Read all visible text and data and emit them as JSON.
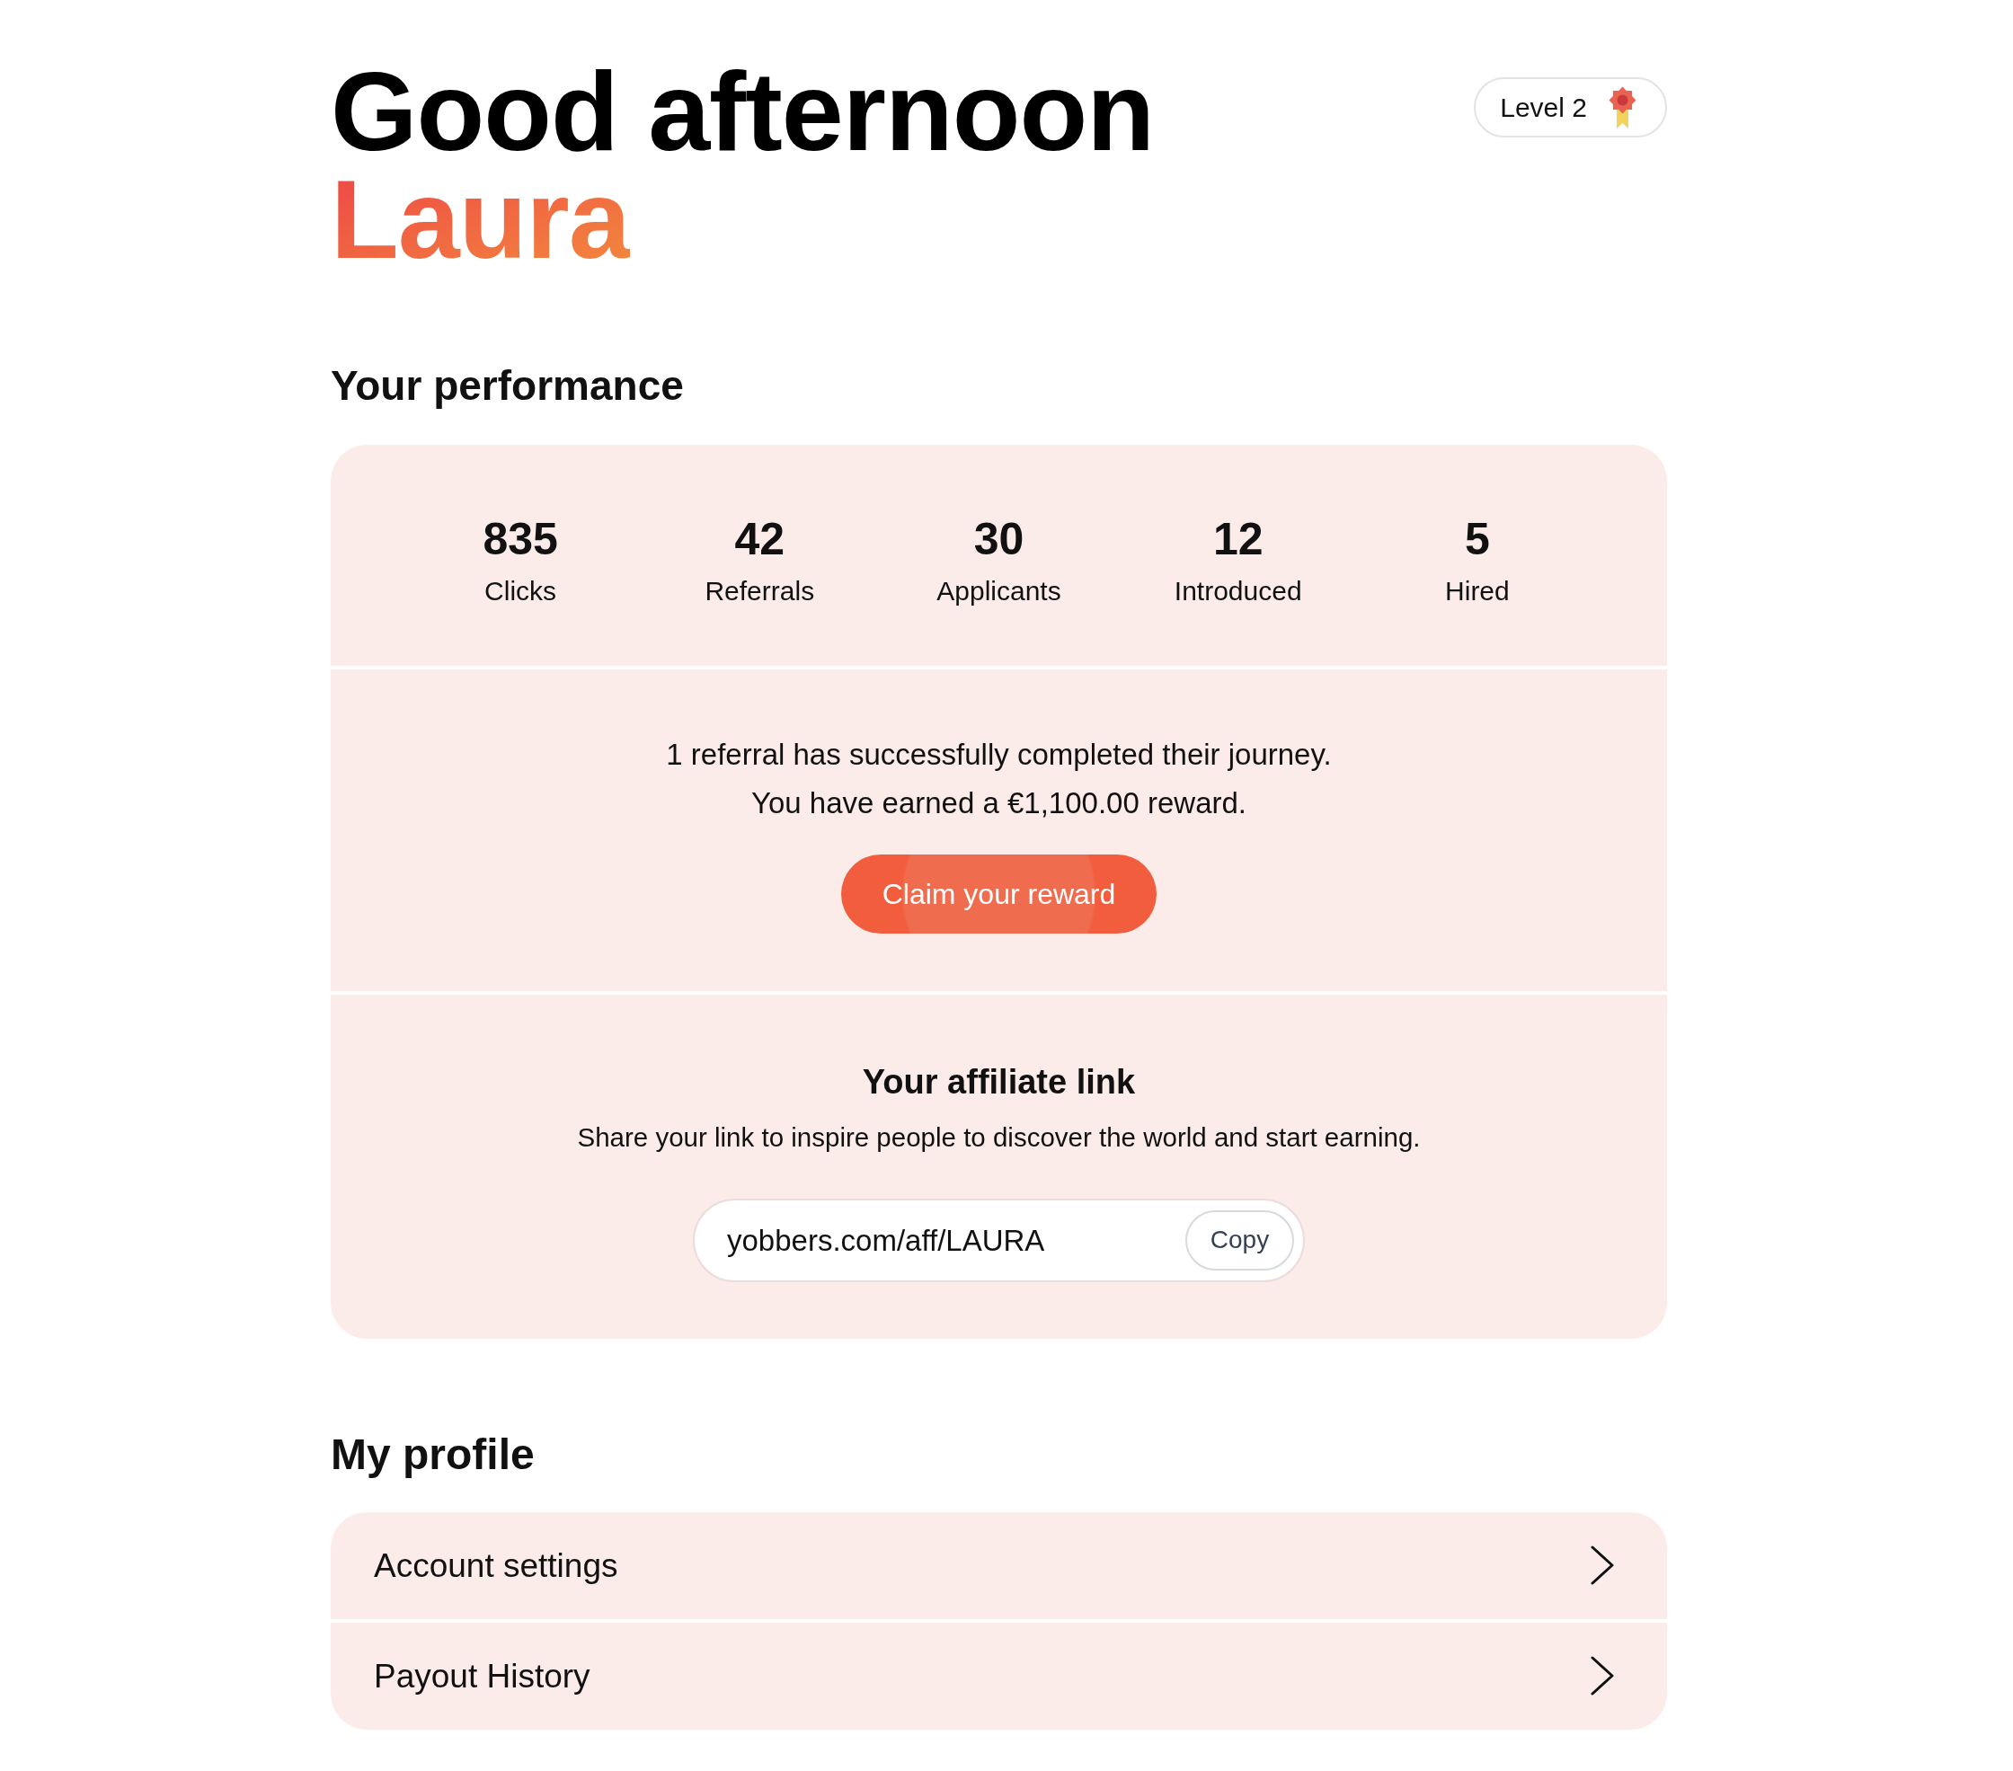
{
  "greeting": {
    "title": "Good afternoon",
    "name": "Laura"
  },
  "level_badge": {
    "label": "Level 2"
  },
  "performance": {
    "heading": "Your performance",
    "stats": [
      {
        "value": "835",
        "label": "Clicks"
      },
      {
        "value": "42",
        "label": "Referrals"
      },
      {
        "value": "30",
        "label": "Applicants"
      },
      {
        "value": "12",
        "label": "Introduced"
      },
      {
        "value": "5",
        "label": "Hired"
      }
    ],
    "reward": {
      "lines": [
        "1 referral has successfully completed their journey.",
        "You have earned a €1,100.00 reward."
      ],
      "button": "Claim your reward"
    },
    "affiliate": {
      "title": "Your affiliate link",
      "description": "Share your link to inspire people to discover the world and start earning.",
      "link": "yobbers.com/aff/LAURA",
      "copy_button": "Copy"
    }
  },
  "profile": {
    "heading": "My profile",
    "items": [
      {
        "label": "Account settings"
      },
      {
        "label": "Payout History"
      }
    ]
  }
}
